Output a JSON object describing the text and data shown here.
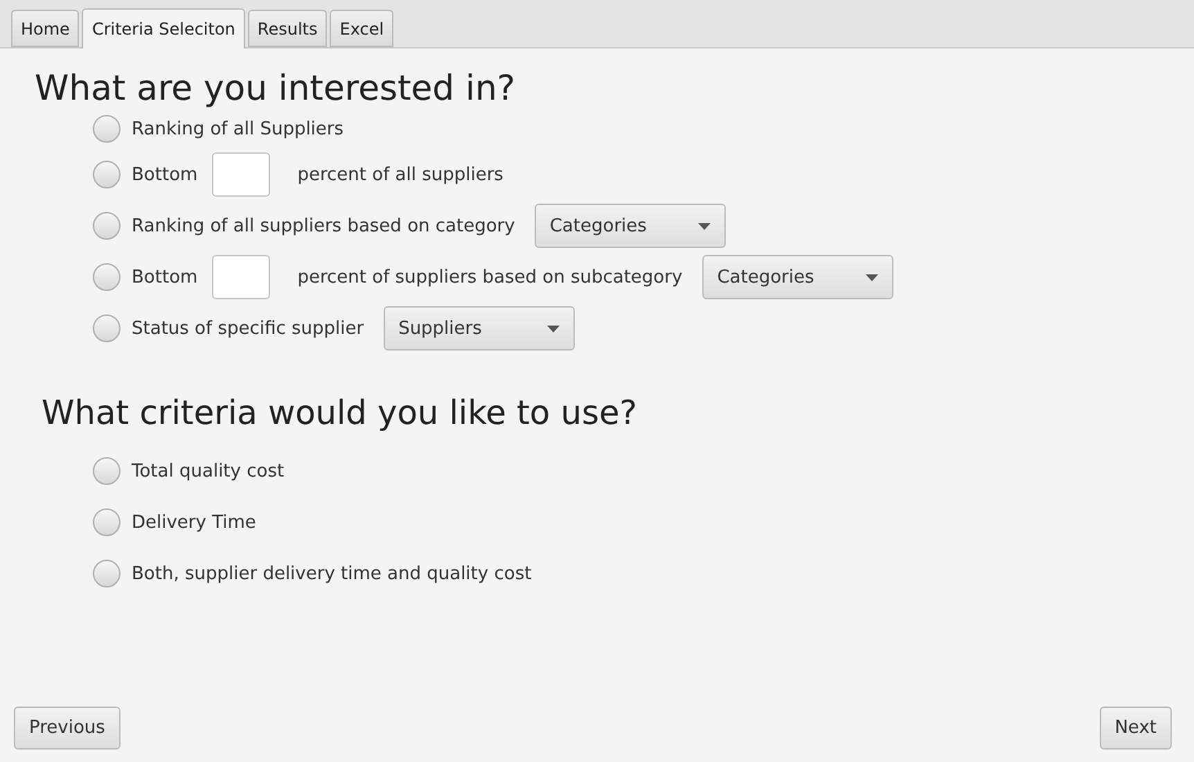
{
  "tabs": [
    {
      "label": "Home",
      "selected": false
    },
    {
      "label": "Criteria Seleciton",
      "selected": true
    },
    {
      "label": "Results",
      "selected": false
    },
    {
      "label": "Excel",
      "selected": false
    }
  ],
  "interest": {
    "heading": "What are you interested in?",
    "options": [
      {
        "selected": false,
        "parts": [
          {
            "kind": "text",
            "text": "Ranking of all Suppliers"
          }
        ]
      },
      {
        "selected": false,
        "parts": [
          {
            "kind": "text",
            "text": "Bottom"
          },
          {
            "kind": "field"
          },
          {
            "kind": "text",
            "text": "percent of all suppliers"
          }
        ]
      },
      {
        "selected": false,
        "parts": [
          {
            "kind": "text",
            "text": "Ranking of all suppliers based on category"
          },
          {
            "kind": "dropdown",
            "text": "Categories"
          }
        ]
      },
      {
        "selected": false,
        "parts": [
          {
            "kind": "text",
            "text": "Bottom"
          },
          {
            "kind": "field"
          },
          {
            "kind": "text",
            "text": "percent of suppliers based on subcategory"
          },
          {
            "kind": "dropdown",
            "text": "Categories"
          }
        ]
      },
      {
        "selected": false,
        "parts": [
          {
            "kind": "text",
            "text": "Status of specific supplier"
          },
          {
            "kind": "dropdown",
            "text": "Suppliers"
          }
        ]
      }
    ]
  },
  "criteria": {
    "heading": "What criteria would you like to use?",
    "options": [
      {
        "selected": false,
        "label": "Total quality cost"
      },
      {
        "selected": false,
        "label": "Delivery Time"
      },
      {
        "selected": false,
        "label": "Both, supplier delivery time and quality cost"
      }
    ]
  },
  "buttons": {
    "previous": "Previous",
    "next": "Next"
  }
}
